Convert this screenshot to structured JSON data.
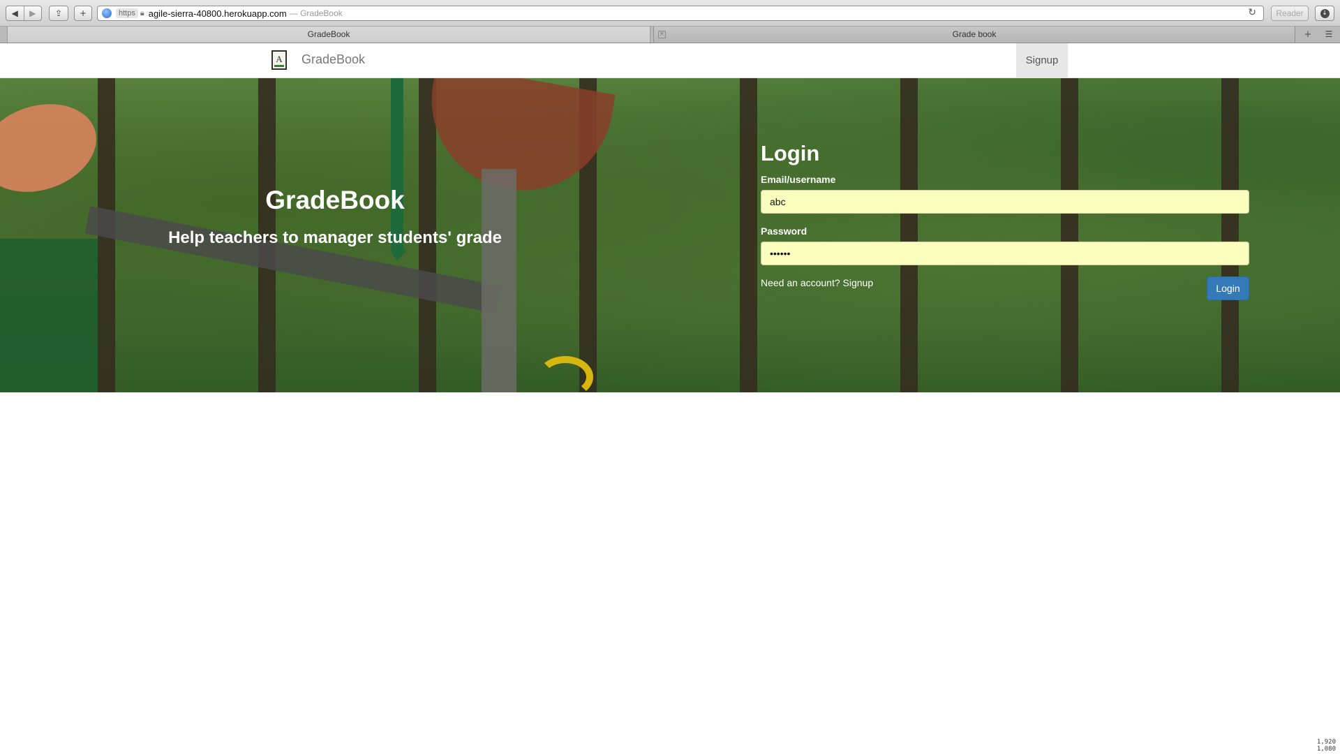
{
  "browser": {
    "back_icon": "back-arrow-icon",
    "forward_icon": "forward-arrow-icon",
    "share_icon": "share-icon",
    "new_tab_icon": "plus-icon",
    "url_scheme": "https",
    "url_host": "agile-sierra-40800.herokuapp.com",
    "url_title": "— GradeBook",
    "reader_label": "Reader",
    "tabs": [
      {
        "label": "GradeBook",
        "active": true
      },
      {
        "label": "Grade book",
        "active": false
      }
    ]
  },
  "navbar": {
    "brand": "GradeBook",
    "logo_letter": "A",
    "signup": "Signup"
  },
  "hero": {
    "title": "GradeBook",
    "subtitle": "Help teachers to manager students' grade"
  },
  "login": {
    "title": "Login",
    "email_label": "Email/username",
    "email_value": "abc",
    "password_label": "Password",
    "password_value": "••••••",
    "need_account": "Need an account?",
    "signup_link": "Signup",
    "submit": "Login"
  },
  "screen": {
    "width_readout": "1,920",
    "height_readout": "1,080"
  },
  "colors": {
    "primary_button": "#337ab7",
    "autofill_input": "#faffbd",
    "nav_active": "#e7e7e7"
  }
}
